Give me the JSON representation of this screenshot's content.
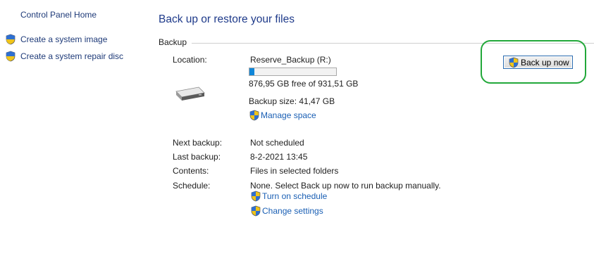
{
  "sidebar": {
    "home": "Control Panel Home",
    "items": [
      {
        "label": "Create a system image",
        "icon": "uac-shield-icon"
      },
      {
        "label": "Create a system repair disc",
        "icon": "uac-shield-icon"
      }
    ]
  },
  "main": {
    "title": "Back up or restore your files",
    "section_label": "Backup",
    "location_label": "Location:",
    "location_value": "Reserve_Backup (R:)",
    "drive_usage": 0.06,
    "free_space": "876,95 GB free of 931,51 GB",
    "backup_size": "Backup size: 41,47 GB",
    "manage_space": "Manage space",
    "back_up_now": "Back up now",
    "details": [
      {
        "label": "Next backup:",
        "value": "Not scheduled"
      },
      {
        "label": "Last backup:",
        "value": "8-2-2021 13:45"
      },
      {
        "label": "Contents:",
        "value": "Files in selected folders"
      },
      {
        "label": "Schedule:",
        "value": "None. Select Back up now to run backup manually."
      }
    ],
    "turn_on_schedule": "Turn on schedule",
    "change_settings": "Change settings"
  },
  "colors": {
    "highlight": "#22a83a",
    "progress": "#0f86d8",
    "link": "#1a5fb4"
  }
}
